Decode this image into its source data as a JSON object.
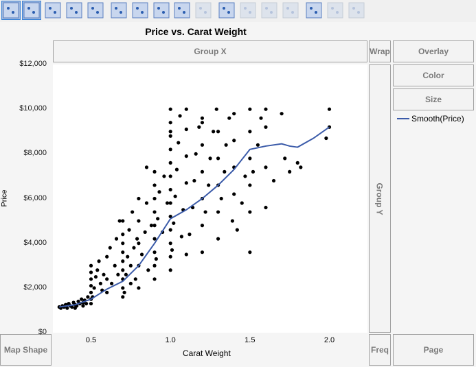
{
  "toolbar": {
    "buttons": [
      "points",
      "smoother",
      "line-of-fit",
      "ellipse",
      "contour",
      "line",
      "bar",
      "area",
      "box-plot",
      "histogram",
      "heatmap",
      "pie",
      "treemap",
      "mosaic",
      "caption-box",
      "formula",
      "map-shapes"
    ],
    "selected": [
      "points",
      "smoother"
    ]
  },
  "title": "Price vs. Carat Weight",
  "zones": {
    "group_x": "Group X",
    "group_y": "Group Y",
    "wrap": "Wrap",
    "overlay": "Overlay",
    "color": "Color",
    "size": "Size",
    "map_shape": "Map Shape",
    "freq": "Freq",
    "page": "Page"
  },
  "legend": {
    "label": "Smooth(Price)",
    "color": "#3b5ba9"
  },
  "chart_data": {
    "type": "scatter",
    "title": "Price vs. Carat Weight",
    "xlabel": "Carat Weight",
    "ylabel": "Price",
    "xlim": [
      0.26,
      2.24
    ],
    "ylim": [
      0,
      12000
    ],
    "xticks": [
      "0.5",
      "1.0",
      "1.5",
      "2.0"
    ],
    "xtick_values": [
      0.5,
      1.0,
      1.5,
      2.0
    ],
    "yticks": [
      "$0",
      "$2,000",
      "$4,000",
      "$6,000",
      "$8,000",
      "$10,000",
      "$12,000"
    ],
    "ytick_values": [
      0,
      2000,
      4000,
      6000,
      8000,
      10000,
      12000
    ],
    "points": [
      [
        0.31,
        1100
      ],
      [
        0.32,
        1200
      ],
      [
        0.33,
        1150
      ],
      [
        0.34,
        1250
      ],
      [
        0.35,
        1100
      ],
      [
        0.36,
        1300
      ],
      [
        0.37,
        1200
      ],
      [
        0.38,
        1150
      ],
      [
        0.39,
        1350
      ],
      [
        0.4,
        1250
      ],
      [
        0.41,
        1200
      ],
      [
        0.42,
        1400
      ],
      [
        0.43,
        1300
      ],
      [
        0.44,
        1500
      ],
      [
        0.45,
        1350
      ],
      [
        0.46,
        1450
      ],
      [
        0.47,
        1300
      ],
      [
        0.48,
        1600
      ],
      [
        0.3,
        1150
      ],
      [
        0.35,
        1250
      ],
      [
        0.4,
        1100
      ],
      [
        0.45,
        1200
      ],
      [
        0.5,
        1300
      ],
      [
        0.5,
        1500
      ],
      [
        0.5,
        1800
      ],
      [
        0.5,
        2100
      ],
      [
        0.5,
        2400
      ],
      [
        0.5,
        2700
      ],
      [
        0.5,
        3000
      ],
      [
        0.51,
        1600
      ],
      [
        0.52,
        2000
      ],
      [
        0.53,
        2500
      ],
      [
        0.54,
        2800
      ],
      [
        0.55,
        3200
      ],
      [
        0.56,
        2200
      ],
      [
        0.57,
        1900
      ],
      [
        0.58,
        2600
      ],
      [
        0.6,
        2400
      ],
      [
        0.6,
        3400
      ],
      [
        0.6,
        1800
      ],
      [
        0.62,
        3800
      ],
      [
        0.63,
        2200
      ],
      [
        0.65,
        3000
      ],
      [
        0.66,
        4200
      ],
      [
        0.67,
        2600
      ],
      [
        0.68,
        5000
      ],
      [
        0.7,
        1600
      ],
      [
        0.7,
        2000
      ],
      [
        0.7,
        2400
      ],
      [
        0.7,
        2800
      ],
      [
        0.7,
        3200
      ],
      [
        0.7,
        3600
      ],
      [
        0.7,
        4000
      ],
      [
        0.7,
        4400
      ],
      [
        0.7,
        5000
      ],
      [
        0.71,
        1800
      ],
      [
        0.72,
        2600
      ],
      [
        0.73,
        3400
      ],
      [
        0.74,
        4600
      ],
      [
        0.75,
        2200
      ],
      [
        0.75,
        3000
      ],
      [
        0.76,
        5400
      ],
      [
        0.77,
        3800
      ],
      [
        0.78,
        2400
      ],
      [
        0.79,
        4200
      ],
      [
        0.8,
        2000
      ],
      [
        0.8,
        3000
      ],
      [
        0.8,
        4000
      ],
      [
        0.8,
        5000
      ],
      [
        0.8,
        6000
      ],
      [
        0.82,
        3500
      ],
      [
        0.84,
        4500
      ],
      [
        0.85,
        5800
      ],
      [
        0.86,
        2800
      ],
      [
        0.88,
        4800
      ],
      [
        0.9,
        2400
      ],
      [
        0.9,
        3000
      ],
      [
        0.9,
        3600
      ],
      [
        0.9,
        4200
      ],
      [
        0.9,
        4800
      ],
      [
        0.9,
        5400
      ],
      [
        0.9,
        6000
      ],
      [
        0.9,
        6600
      ],
      [
        0.9,
        7200
      ],
      [
        0.91,
        3300
      ],
      [
        0.92,
        5100
      ],
      [
        0.93,
        6300
      ],
      [
        0.95,
        4500
      ],
      [
        0.96,
        7000
      ],
      [
        0.98,
        5800
      ],
      [
        1.0,
        2800
      ],
      [
        1.0,
        3400
      ],
      [
        1.0,
        4000
      ],
      [
        1.0,
        4600
      ],
      [
        1.0,
        5200
      ],
      [
        1.0,
        5800
      ],
      [
        1.0,
        6400
      ],
      [
        1.0,
        7000
      ],
      [
        1.0,
        7600
      ],
      [
        1.0,
        8200
      ],
      [
        1.0,
        8800
      ],
      [
        1.0,
        9400
      ],
      [
        1.0,
        10000
      ],
      [
        1.01,
        3700
      ],
      [
        1.02,
        4900
      ],
      [
        1.03,
        6100
      ],
      [
        1.04,
        7300
      ],
      [
        1.05,
        8500
      ],
      [
        1.06,
        9700
      ],
      [
        1.07,
        4300
      ],
      [
        1.08,
        5500
      ],
      [
        1.1,
        3500
      ],
      [
        1.1,
        6700
      ],
      [
        1.1,
        7900
      ],
      [
        1.1,
        9100
      ],
      [
        1.1,
        10000
      ],
      [
        1.12,
        4400
      ],
      [
        1.14,
        5600
      ],
      [
        1.15,
        6800
      ],
      [
        1.16,
        8000
      ],
      [
        1.18,
        9200
      ],
      [
        1.2,
        3600
      ],
      [
        1.2,
        4800
      ],
      [
        1.2,
        6000
      ],
      [
        1.2,
        7200
      ],
      [
        1.2,
        8400
      ],
      [
        1.2,
        9600
      ],
      [
        1.22,
        5400
      ],
      [
        1.24,
        6600
      ],
      [
        1.25,
        7800
      ],
      [
        1.27,
        9000
      ],
      [
        1.29,
        10000
      ],
      [
        1.3,
        4200
      ],
      [
        1.3,
        5400
      ],
      [
        1.3,
        6600
      ],
      [
        1.3,
        7800
      ],
      [
        1.3,
        9000
      ],
      [
        1.32,
        6000
      ],
      [
        1.34,
        7200
      ],
      [
        1.35,
        8400
      ],
      [
        1.37,
        9600
      ],
      [
        1.39,
        5000
      ],
      [
        1.4,
        6200
      ],
      [
        1.4,
        7400
      ],
      [
        1.4,
        8600
      ],
      [
        1.4,
        9800
      ],
      [
        1.42,
        4600
      ],
      [
        1.45,
        5800
      ],
      [
        1.47,
        7000
      ],
      [
        1.5,
        3600
      ],
      [
        1.5,
        5400
      ],
      [
        1.5,
        6600
      ],
      [
        1.5,
        7800
      ],
      [
        1.5,
        9000
      ],
      [
        1.5,
        10000
      ],
      [
        1.52,
        7200
      ],
      [
        1.55,
        8400
      ],
      [
        1.57,
        9600
      ],
      [
        1.6,
        5600
      ],
      [
        1.6,
        7400
      ],
      [
        1.6,
        9200
      ],
      [
        1.6,
        10000
      ],
      [
        1.65,
        6800
      ],
      [
        1.7,
        9800
      ],
      [
        1.72,
        7800
      ],
      [
        1.75,
        7200
      ],
      [
        1.8,
        7600
      ],
      [
        1.82,
        7400
      ],
      [
        1.2,
        9400
      ],
      [
        0.85,
        7400
      ],
      [
        1.0,
        9000
      ],
      [
        2.0,
        10000
      ],
      [
        2.0,
        9200
      ],
      [
        1.98,
        8700
      ]
    ],
    "smooth": {
      "name": "Smooth(Price)",
      "x": [
        0.3,
        0.4,
        0.5,
        0.6,
        0.7,
        0.8,
        0.9,
        1.0,
        1.1,
        1.2,
        1.3,
        1.4,
        1.5,
        1.6,
        1.7,
        1.75,
        1.8,
        1.9,
        2.0
      ],
      "y": [
        1150,
        1250,
        1500,
        1950,
        2300,
        3000,
        4000,
        5100,
        5500,
        6000,
        6600,
        7300,
        8200,
        8350,
        8450,
        8350,
        8300,
        8700,
        9200
      ]
    }
  }
}
